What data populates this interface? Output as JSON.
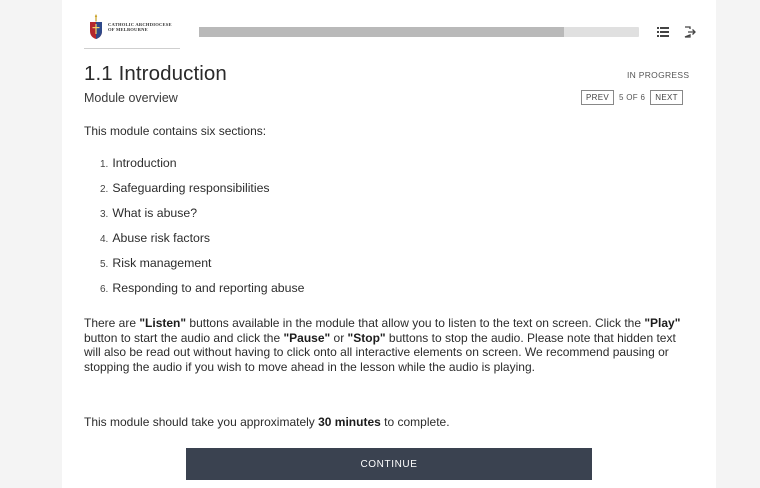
{
  "header": {
    "logo_text": "CATHOLIC ARCHDIOCESE OF MELBOURNE",
    "progress": 0.83,
    "menu_icon": "list-icon",
    "exit_icon": "exit-icon"
  },
  "lesson": {
    "title": "1.1 Introduction",
    "status": "IN PROGRESS",
    "subtitle": "Module overview",
    "prev_label": "PREV",
    "page_count": "5 OF 6",
    "next_label": "NEXT"
  },
  "content": {
    "intro": "This module contains six sections:",
    "sections": [
      {
        "num": "1.",
        "label": "Introduction"
      },
      {
        "num": "2.",
        "label": "Safeguarding responsibilities"
      },
      {
        "num": "3.",
        "label": "What is abuse?"
      },
      {
        "num": "4.",
        "label": "Abuse risk factors"
      },
      {
        "num": "5.",
        "label": "Risk management"
      },
      {
        "num": "6.",
        "label": "Responding to and reporting abuse"
      }
    ],
    "para": {
      "t1": "There are ",
      "listen": "\"Listen\"",
      "t2": " buttons available in the module that allow you to listen to the text on screen. Click the ",
      "play": "\"Play\"",
      "t3": " button to start the audio and click the ",
      "pause": "\"Pause\"",
      "t4": " or ",
      "stop": "\"Stop\"",
      "t5": " buttons to stop the audio. Please note that hidden text will also be read out without having to click onto all interactive elements on screen. We recommend pausing or stopping the audio if you wish to move ahead in the lesson while the audio is playing."
    },
    "time": {
      "t1": "This module should take you approximately ",
      "duration": "30 minutes",
      "t2": " to complete."
    }
  },
  "footer": {
    "continue_label": "CONTINUE"
  },
  "colors": {
    "button_bg": "#3a4250",
    "progress_track": "#e0e0e0",
    "progress_fill": "#b9b9b9"
  }
}
